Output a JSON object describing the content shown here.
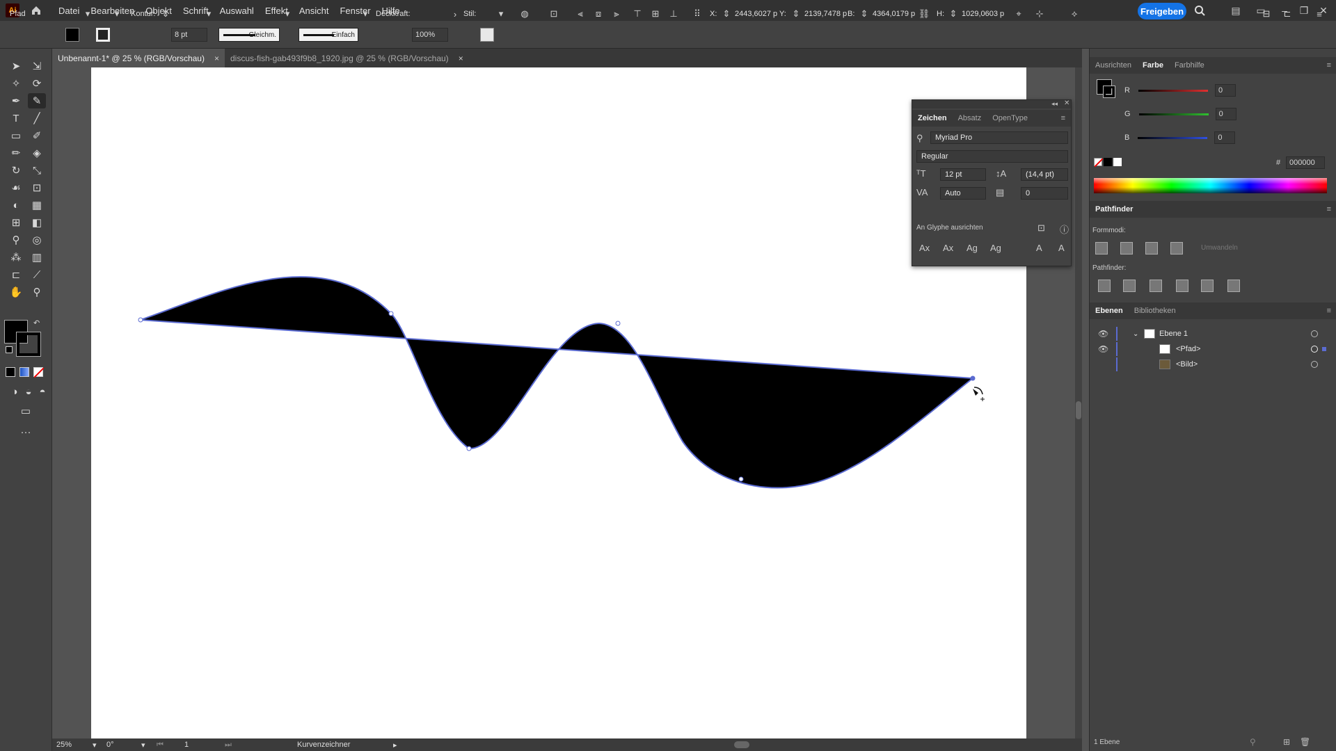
{
  "app": {
    "logo": "Ai",
    "menus": [
      "Datei",
      "Bearbeiten",
      "Objekt",
      "Schrift",
      "Auswahl",
      "Effekt",
      "Ansicht",
      "Fenster",
      "Hilfe"
    ],
    "share_label": "Freigeben"
  },
  "control": {
    "selection_type": "Pfad",
    "stroke_label": "Kontur:",
    "stroke_weight": "8 pt",
    "stroke_profile": "Gleichm.",
    "brush": "Einfach",
    "opacity_label": "Deckkraft:",
    "opacity": "100%",
    "style_label": "Stil:",
    "x_label": "X:",
    "x": "2443,6027 p",
    "y_label": "Y:",
    "y": "2139,7478 p",
    "w_label": "B:",
    "w": "4364,0179 p",
    "h_label": "H:",
    "h": "1029,0603 p"
  },
  "tabs": [
    {
      "label": "Unbenannt-1* @ 25 % (RGB/Vorschau)",
      "close": "×",
      "active": true
    },
    {
      "label": "discus-fish-gab493f9b8_1920.jpg @ 25 % (RGB/Vorschau)",
      "close": "×",
      "active": false
    }
  ],
  "char_panel": {
    "tabs": [
      "Zeichen",
      "Absatz",
      "OpenType"
    ],
    "font_family": "Myriad Pro",
    "font_style": "Regular",
    "font_size": "12 pt",
    "leading": "(14,4 pt)",
    "kerning": "Auto",
    "tracking": "0",
    "snap_label": "An Glyphe ausrichten"
  },
  "color_panel": {
    "tabs": [
      "Ausrichten",
      "Farbe",
      "Farbhilfe"
    ],
    "channels": [
      {
        "name": "R",
        "value": "0",
        "color": "#e03030"
      },
      {
        "name": "G",
        "value": "0",
        "color": "#30c030"
      },
      {
        "name": "B",
        "value": "0",
        "color": "#3050e0"
      }
    ],
    "hex_label": "#",
    "hex": "000000"
  },
  "pathfinder": {
    "title": "Pathfinder",
    "shape_modes_label": "Formmodi:",
    "expand_label": "Umwandeln",
    "pathfinders_label": "Pathfinder:"
  },
  "layers": {
    "tabs": [
      "Ebenen",
      "Bibliotheken"
    ],
    "items": [
      {
        "name": "Ebene 1"
      },
      {
        "name": "<Pfad>"
      },
      {
        "name": "<Bild>"
      }
    ],
    "footer": "1 Ebene"
  },
  "status": {
    "zoom": "25%",
    "rotation": "0°",
    "artboard": "1",
    "tool": "Kurvenzeichner"
  },
  "colors": {
    "accent": "#1473e6",
    "path_outline": "#5b6bd1",
    "fill": "#000000"
  }
}
